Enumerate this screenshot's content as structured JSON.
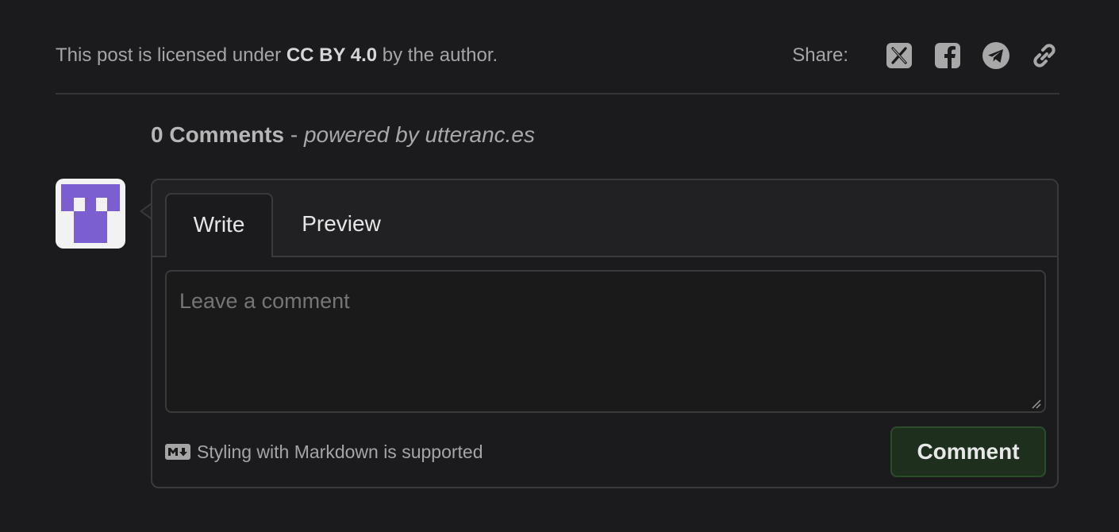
{
  "license": {
    "prefix": "This post is licensed under ",
    "license_name": "CC BY 4.0",
    "suffix": " by the author."
  },
  "share": {
    "label": "Share:",
    "icons": [
      "x-twitter-icon",
      "facebook-icon",
      "telegram-icon",
      "link-icon"
    ]
  },
  "comments": {
    "count_label": "0 Comments",
    "separator": " - ",
    "powered_by": "powered by utteranc.es"
  },
  "editor": {
    "tabs": {
      "write": "Write",
      "preview": "Preview"
    },
    "placeholder": "Leave a comment",
    "markdown_note": "Styling with Markdown is supported",
    "submit_label": "Comment"
  },
  "colors": {
    "background": "#1b1b1e",
    "avatar_purple": "#7b5fd0",
    "button_bg": "#1e2f1e"
  }
}
